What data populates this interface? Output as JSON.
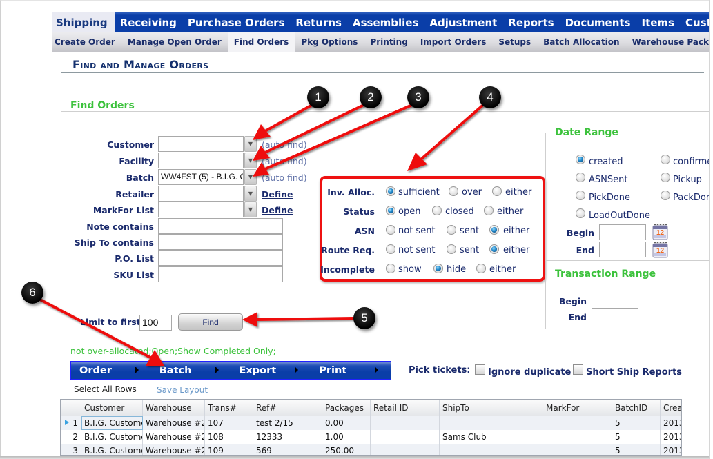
{
  "top_nav": {
    "tabs": [
      "Shipping",
      "Receiving",
      "Purchase Orders",
      "Returns",
      "Assemblies",
      "Adjustment",
      "Reports",
      "Documents",
      "Items",
      "Customer"
    ],
    "active": "Shipping"
  },
  "sub_nav": {
    "tabs": [
      "Create Order",
      "Manage Open Order",
      "Find Orders",
      "Pkg Options",
      "Printing",
      "Import Orders",
      "Setups",
      "Batch Allocation",
      "Warehouse Pack"
    ],
    "active": "Find Orders"
  },
  "page_title": "Find and Manage Orders",
  "find_orders": {
    "legend": "Find Orders",
    "customer": {
      "label": "Customer",
      "value": "",
      "hint": "(auto find)"
    },
    "facility": {
      "label": "Facility",
      "value": "",
      "hint": "(auto find)"
    },
    "batch": {
      "label": "Batch",
      "value": "WW4FST (5) - B.I.G. C",
      "hint": "(auto find)"
    },
    "retailer": {
      "label": "Retailer",
      "value": "",
      "link": "Define"
    },
    "markfor": {
      "label": "MarkFor List",
      "value": "",
      "link": "Define"
    },
    "note": {
      "label": "Note contains",
      "value": ""
    },
    "shipto": {
      "label": "Ship To contains",
      "value": ""
    },
    "po": {
      "label": "P.O. List",
      "value": ""
    },
    "sku": {
      "label": "SKU List",
      "value": ""
    },
    "limit_label": "Limit to first",
    "limit_value": "100",
    "find_button": "Find"
  },
  "filters": {
    "inv_alloc": {
      "label": "Inv. Alloc.",
      "options": [
        "sufficient",
        "over",
        "either"
      ],
      "selected": "sufficient"
    },
    "status": {
      "label": "Status",
      "options": [
        "open",
        "closed",
        "either"
      ],
      "selected": "open"
    },
    "asn": {
      "label": "ASN",
      "options": [
        "not sent",
        "sent",
        "either"
      ],
      "selected": "either"
    },
    "route_req": {
      "label": "Route Req.",
      "options": [
        "not sent",
        "sent",
        "either"
      ],
      "selected": "either"
    },
    "incomplete": {
      "label": "Incomplete",
      "options": [
        "show",
        "hide",
        "either"
      ],
      "selected": "hide"
    }
  },
  "date_range": {
    "legend": "Date Range",
    "options": [
      "created",
      "confirme",
      "ASNSent",
      "Pickup",
      "PickDone",
      "PackDor",
      "LoadOutDone"
    ],
    "selected": "created",
    "begin_label": "Begin",
    "end_label": "End",
    "begin_value": "",
    "end_value": "",
    "calendar_icon_text": "12"
  },
  "transaction_range": {
    "legend": "Transaction Range",
    "begin_label": "Begin",
    "end_label": "End",
    "begin_value": "",
    "end_value": ""
  },
  "criteria_text": "not over-allocated;Open;Show Completed Only;",
  "action_menu": [
    "Order",
    "Batch",
    "Export",
    "Print"
  ],
  "pick_tickets": {
    "label": "Pick tickets:",
    "ignore_duplicate": {
      "label": "Ignore duplicate",
      "checked": false
    },
    "short_ship": {
      "label": "Short Ship Reports",
      "checked": false
    }
  },
  "select_all_label": "Select All Rows",
  "select_all_checked": false,
  "save_layout": "Save Layout",
  "grid": {
    "columns": [
      "",
      "Customer",
      "Warehouse",
      "Trans#",
      "Ref#",
      "Packages",
      "Retail ID",
      "ShipTo",
      "MarkFor",
      "BatchID",
      "Crea"
    ],
    "rows": [
      [
        "1",
        "B.I.G. Custome",
        "Warehouse #2",
        "107",
        "test 2/15",
        "0.00",
        "",
        "",
        "",
        "5",
        "2013"
      ],
      [
        "2",
        "B.I.G. Custome",
        "Warehouse #2",
        "108",
        "12333",
        "1.00",
        "",
        "Sams Club",
        "",
        "5",
        "2013"
      ],
      [
        "3",
        "B.I.G. Custome",
        "Warehouse #2",
        "109",
        "569",
        "250.00",
        "",
        "",
        "",
        "5",
        "2013"
      ]
    ]
  },
  "annotations": [
    "1",
    "2",
    "3",
    "4",
    "5",
    "6"
  ],
  "colors": {
    "nav_blue": "#0a3ea8",
    "legend_green": "#3cc23c",
    "label_navy": "#1a2a6c",
    "annotation_red": "#ee1111"
  }
}
